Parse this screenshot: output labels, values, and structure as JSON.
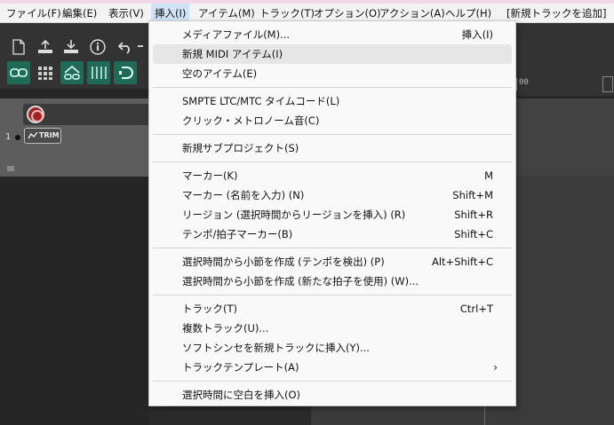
{
  "menubar": {
    "items": [
      "ファイル(F)",
      "編集(E)",
      "表示(V)",
      "挿入(I)",
      "アイテム(M)",
      "トラック(T)",
      "オプション(O)",
      "アクション(A)",
      "ヘルプ(H)",
      "[新規トラックを追加]"
    ]
  },
  "track": {
    "number": "1",
    "trim_label": "TRIM"
  },
  "ruler": {
    "label": "00"
  },
  "menu": {
    "items": [
      {
        "label": "メディアファイル(M)...",
        "shortcut": "挿入(I)"
      },
      {
        "label": "新規 MIDI アイテム(I)",
        "shortcut": ""
      },
      {
        "label": "空のアイテム(E)",
        "shortcut": ""
      },
      {
        "label": "SMPTE LTC/MTC タイムコード(L)",
        "shortcut": ""
      },
      {
        "label": "クリック・メトロノーム音(C)",
        "shortcut": ""
      },
      {
        "label": "新規サブプロジェクト(S)",
        "shortcut": ""
      },
      {
        "label": "マーカー(K)",
        "shortcut": "M"
      },
      {
        "label": "マーカー (名前を入力) (N)",
        "shortcut": "Shift+M"
      },
      {
        "label": "リージョン (選択時間からリージョンを挿入) (R)",
        "shortcut": "Shift+R"
      },
      {
        "label": "テンポ/拍子マーカー(B)",
        "shortcut": "Shift+C"
      },
      {
        "label": "選択時間から小節を作成 (テンポを検出) (P)",
        "shortcut": "Alt+Shift+C"
      },
      {
        "label": "選択時間から小節を作成 (新たな拍子を使用) (W)...",
        "shortcut": ""
      },
      {
        "label": "トラック(T)",
        "shortcut": "Ctrl+T"
      },
      {
        "label": "複数トラック(U)...",
        "shortcut": ""
      },
      {
        "label": "ソフトシンセを新規トラックに挿入(Y)...",
        "shortcut": ""
      },
      {
        "label": "トラックテンプレート(A)",
        "shortcut": "",
        "submenu_arrow": "›"
      },
      {
        "label": "選択時間に空白を挿入(O)",
        "shortcut": ""
      }
    ]
  },
  "colors": {
    "accent": "#1f6b58",
    "menu_highlight": "#e6e6e6",
    "record": "#a52222"
  }
}
